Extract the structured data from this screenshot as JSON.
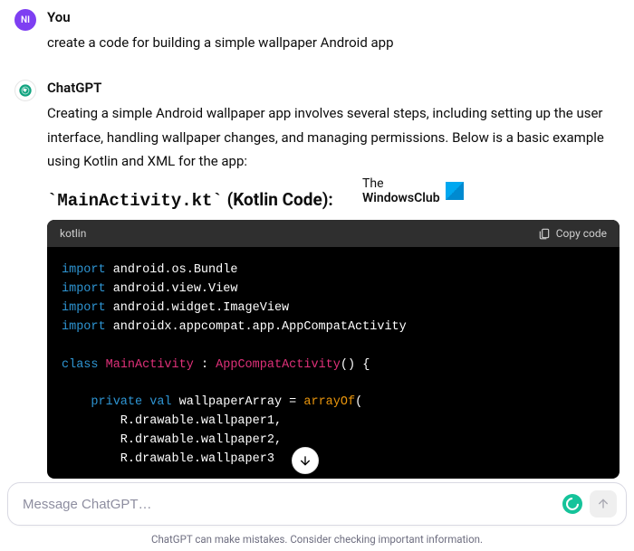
{
  "user": {
    "initials": "NI",
    "sender": "You",
    "text": "create a code for building a simple wallpaper Android app"
  },
  "bot": {
    "sender": "ChatGPT",
    "text": "Creating a simple Android wallpaper app involves several steps, including setting up the user interface, handling wallpaper changes, and managing permissions. Below is a basic example using Kotlin and XML for the app:",
    "heading_code": "`MainActivity.kt`",
    "heading_rest": " (Kotlin Code):"
  },
  "watermark": {
    "l1": "The",
    "l2": "WindowsClub"
  },
  "code": {
    "lang": "kotlin",
    "copy": "Copy code",
    "kw_import": "import",
    "kw_class": "class",
    "kw_private": "private",
    "kw_val": "val",
    "imp1": " android.os.Bundle",
    "imp2": " android.view.View",
    "imp3": " android.widget.ImageView",
    "imp4": " androidx.appcompat.app.AppCompatActivity",
    "cls_name": "MainActivity",
    "colon": " : ",
    "base": "AppCompatActivity",
    "parens_brace": "() {",
    "field": " wallpaperArray = ",
    "arrayof": "arrayOf",
    "open_paren": "(",
    "arr1": "        R.drawable.wallpaper1,",
    "arr2": "        R.drawable.wallpaper2,",
    "arr3": "        R.drawable.wallpaper3"
  },
  "input": {
    "placeholder": "Message ChatGPT…"
  },
  "disclaimer": "ChatGPT can make mistakes. Consider checking important information."
}
